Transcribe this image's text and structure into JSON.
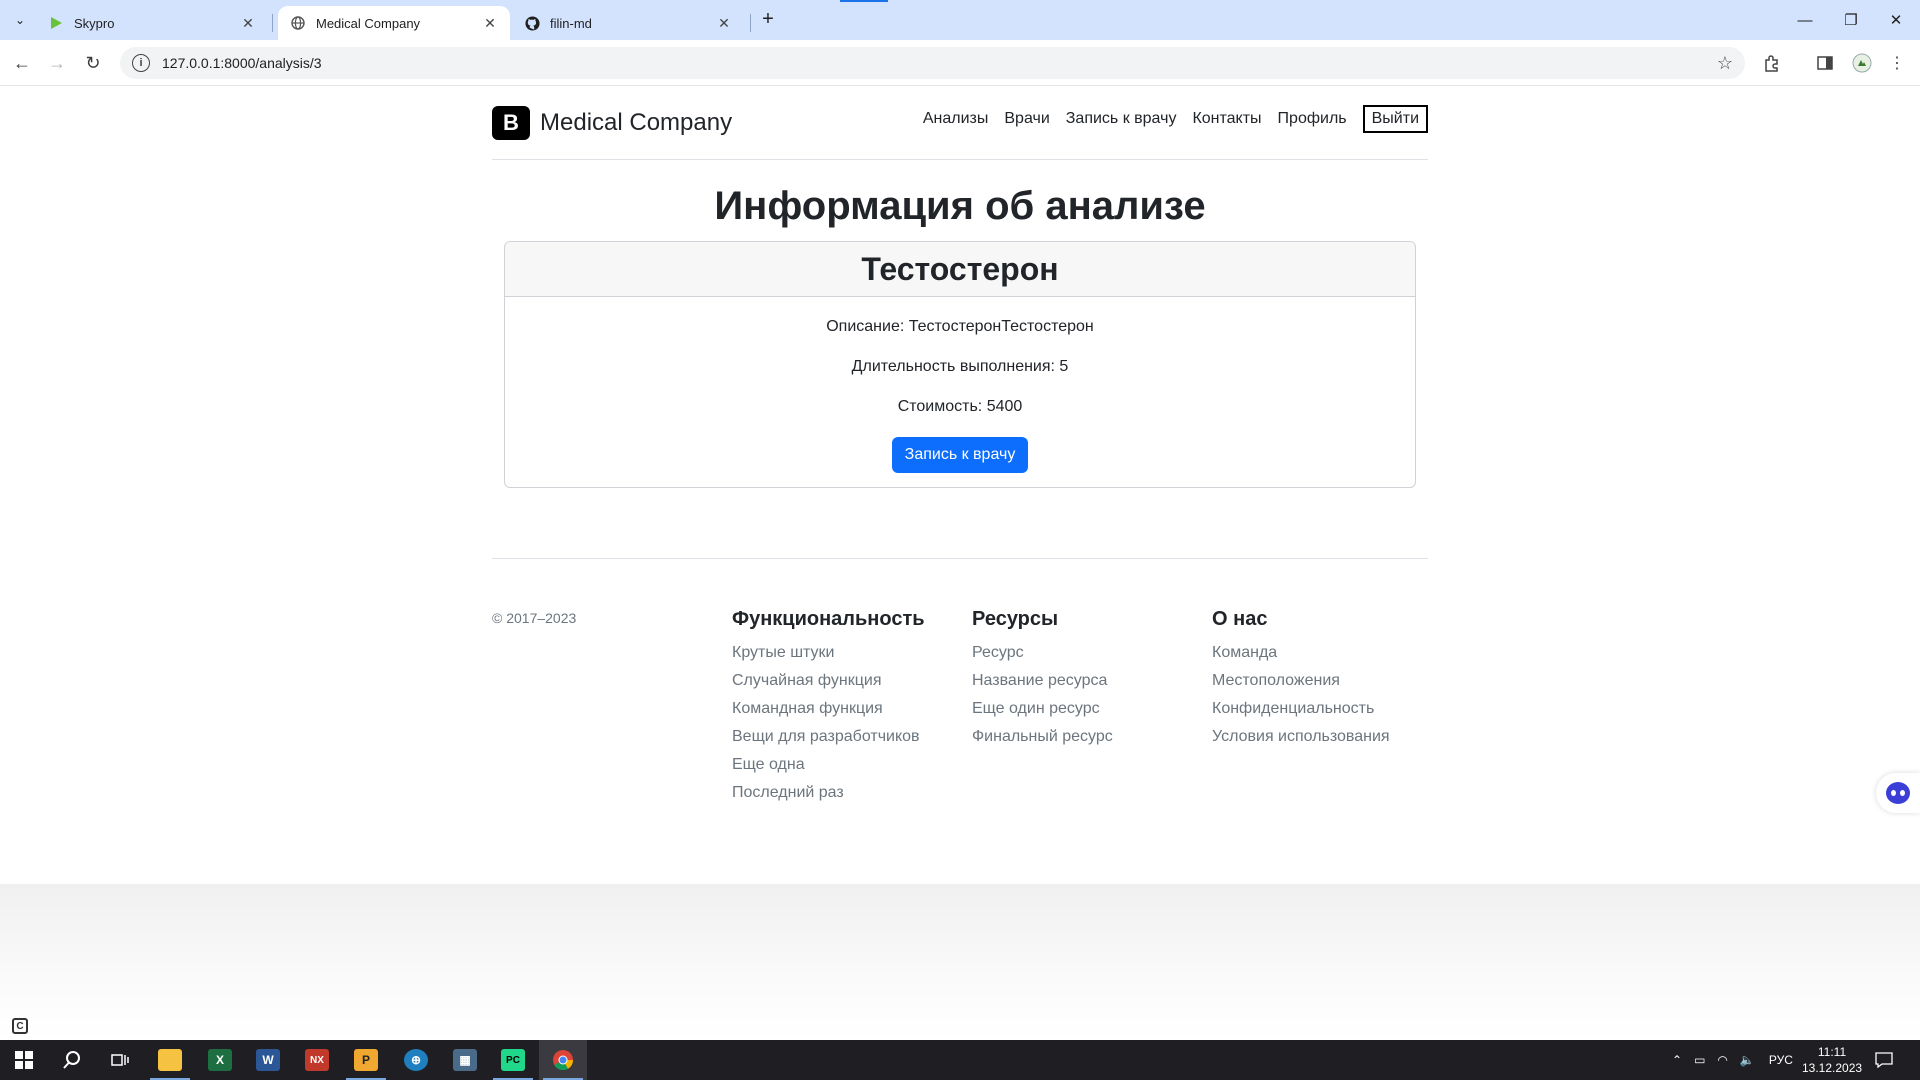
{
  "browser": {
    "tabs": [
      {
        "title": "Skypro",
        "icon": "skypro-play-icon",
        "active": false
      },
      {
        "title": "Medical Company",
        "icon": "globe-icon",
        "active": true
      },
      {
        "title": "filin-md",
        "icon": "github-icon",
        "active": false
      }
    ],
    "url": "127.0.0.1:8000/analysis/3",
    "accent_color": "#1a73e8"
  },
  "header": {
    "brand_logo": "B",
    "brand_name": "Medical Company",
    "nav": [
      "Анализы",
      "Врачи",
      "Запись к врачу",
      "Контакты",
      "Профиль"
    ],
    "logout": "Выйти"
  },
  "main": {
    "title": "Информация об анализе",
    "analysis": {
      "name": "Тестостерон",
      "description": "Описание: ТестостеронТестостерон",
      "duration": "Длительность выполнения: 5",
      "price": "Стоимость: 5400",
      "button": "Запись к врачу",
      "button_color": "#0d6efd"
    }
  },
  "footer": {
    "copyright": "© 2017–2023",
    "columns": [
      {
        "heading": "Функциональность",
        "links": [
          "Крутые штуки",
          "Случайная функция",
          "Командная функция",
          "Вещи для разработчиков",
          "Еще одна",
          "Последний раз"
        ]
      },
      {
        "heading": "Ресурсы",
        "links": [
          "Ресурс",
          "Название ресурса",
          "Еще один ресурс",
          "Финальный ресурс"
        ]
      },
      {
        "heading": "О нас",
        "links": [
          "Команда",
          "Местоположения",
          "Конфиденциальность",
          "Условия использования"
        ]
      }
    ]
  },
  "taskbar": {
    "apps": [
      "file-explorer",
      "excel",
      "word",
      "nx",
      "pdf-editor",
      "network-tool",
      "calculator",
      "pycharm",
      "chrome"
    ],
    "language": "РУС",
    "time": "11:11",
    "date": "13.12.2023"
  }
}
